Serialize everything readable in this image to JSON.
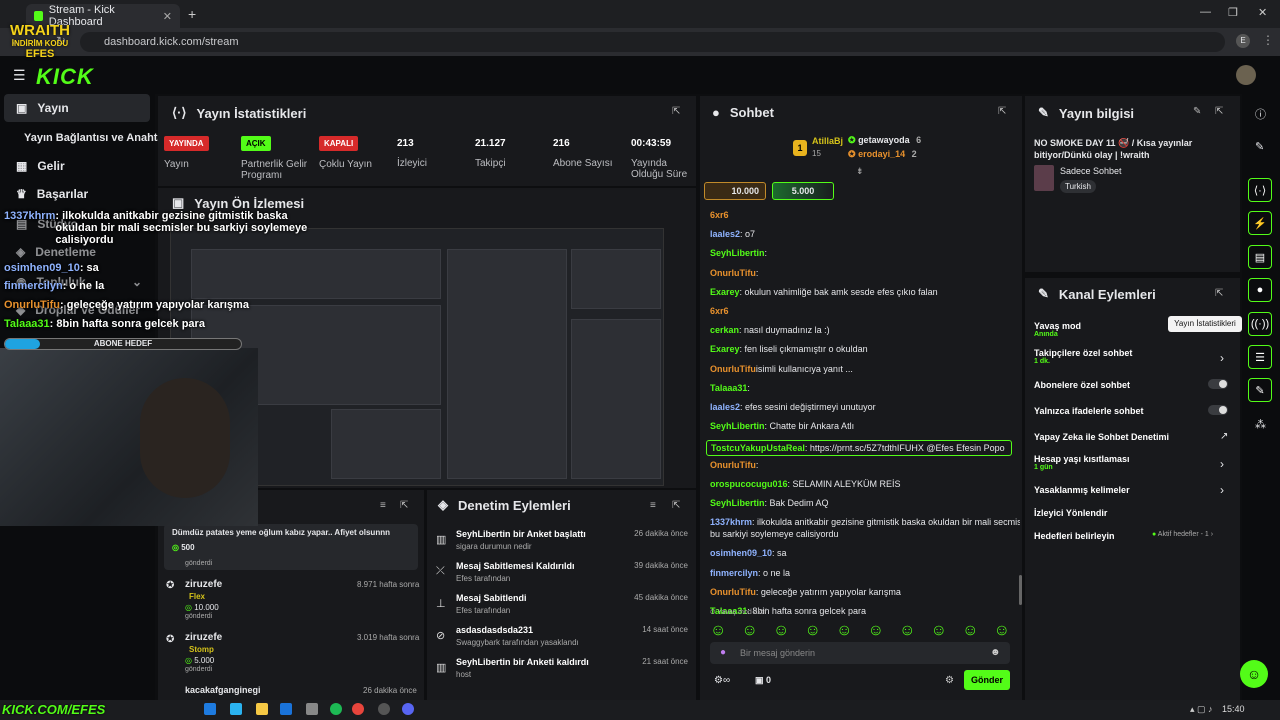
{
  "browser": {
    "tab_title": "Stream - Kick Dashboard",
    "url": "dashboard.kick.com/stream",
    "profile": "E"
  },
  "logo": "KICK",
  "overlay_brand": {
    "line1": "WRAITH",
    "line2": "İNDİRİM KODU",
    "line3": "EFES",
    "bottom": "KICK.COM/EFES"
  },
  "nav": {
    "items": [
      {
        "label": "Yayın"
      },
      {
        "label": "Gelir"
      },
      {
        "label": "Başarılar"
      },
      {
        "label": "Stüdyo"
      },
      {
        "label": "Denetleme"
      },
      {
        "label": "Topluluk"
      },
      {
        "label": "Droplar ve Ödüller"
      }
    ],
    "sub": "Yayın Bağlantısı ve Anahtarı"
  },
  "stats": {
    "title": "Yayın İstatistikleri",
    "items": [
      {
        "badge": "YAYINDA",
        "label": "Yayın"
      },
      {
        "badge": "AÇIK",
        "label": "Partnerlik Gelir Programı"
      },
      {
        "badge": "KAPALI",
        "label": "Çoklu Yayın"
      },
      {
        "value": "213",
        "label": "İzleyici"
      },
      {
        "value": "21.127",
        "label": "Takipçi"
      },
      {
        "value": "216",
        "label": "Abone Sayısı"
      },
      {
        "value": "00:43:59",
        "label": "Yayında Olduğu Süre"
      }
    ]
  },
  "preview": {
    "title": "Yayın Ön İzlemesi"
  },
  "overlay_chat": [
    {
      "user": "1337khrm",
      "text": ": ilkokulda anitkabir gezisine gitmistik baska okuldan bir mali secmisler bu sarkiyi soylemeye calisiyordu"
    },
    {
      "user": "osimhen09_10",
      "text": ": sa"
    },
    {
      "user": "finmercilyn",
      "text": ": o ne la"
    },
    {
      "user": "OnurluTifu",
      "text": ": geleceğe yatırım yapıyolar karışma"
    },
    {
      "user": "Talaaa31",
      "text": ": 8bin hafta sonra gelcek para"
    }
  ],
  "abone_hedef": {
    "label": "ABONE HEDEF",
    "progress": 0.15
  },
  "activity": [
    {
      "text": "Dümdüz patates yeme oğlum kabız yapar.. Afiyet olsunnn",
      "amount": "500",
      "sub": "gönderdi"
    },
    {
      "user": "ziruzefe",
      "time": "8.971 hafta sonra",
      "item": "Flex",
      "amount": "10.000",
      "sub": "gönderdi"
    },
    {
      "user": "ziruzefe",
      "time": "3.019 hafta sonra",
      "item": "Stomp",
      "amount": "5.000",
      "sub": "gönderdi"
    },
    {
      "user": "kacakafganginegi",
      "time": "26 dakika önce"
    }
  ],
  "moderation": {
    "title": "Denetim Eylemleri",
    "items": [
      {
        "title": "SeyhLibertin bir Anket başlattı",
        "sub": "sigara durumun nedir",
        "time": "26 dakika önce"
      },
      {
        "title": "Mesaj Sabitlemesi Kaldırıldı",
        "sub": "Efes tarafından",
        "time": "39 dakika önce"
      },
      {
        "title": "Mesaj Sabitlendi",
        "sub": "Efes tarafından",
        "time": "45 dakika önce"
      },
      {
        "title": "asdasdasdsda231",
        "sub": "Swaggybark tarafından yasaklandı",
        "time": "14 saat önce"
      },
      {
        "title": "SeyhLibertin bir Anketi kaldırdı",
        "sub": "host",
        "time": "21 saat önce"
      }
    ]
  },
  "chat": {
    "title": "Sohbet",
    "top": [
      {
        "name": "AtillaBj",
        "count": "15"
      },
      {
        "name": "getawayoda",
        "count": "6"
      },
      {
        "name": "erodayi_14",
        "count": "2"
      }
    ],
    "rank": "1",
    "goals": [
      "10.000",
      "5.000"
    ],
    "messages": [
      {
        "user": "6xr6",
        "text": ""
      },
      {
        "user": "laales2",
        "text": ": o7"
      },
      {
        "user": "SeyhLibertin",
        "text": ":"
      },
      {
        "user": "OnurluTifu",
        "text": ":"
      },
      {
        "user": "Exarey",
        "text": ": okulun vahimliğe bak amk sesde efes çıkıo falan"
      },
      {
        "user": "6xr6",
        "text": ""
      },
      {
        "user": "cerkan",
        "text": ": nasıl duymadınız la :)"
      },
      {
        "user": "Exarey",
        "text": ": fen liseli çıkmamıştır o okuldan"
      },
      {
        "user": "OnurluTifu",
        "text": "isimli kullanıcıya yanıt ..."
      },
      {
        "user": "Talaaa31",
        "text": ":"
      },
      {
        "user": "laales2",
        "text": ": efes sesini değiştirmeyi unutuyor"
      },
      {
        "user": "SeyhLibertin",
        "text": ": Chatte bir Ankara Atlı"
      },
      {
        "user": "TostcuYakupUstaReal",
        "text": ": https://prnt.sc/5Z7tdthIFUHX @Efes Efesin Popo"
      },
      {
        "user": "OnurluTifu",
        "text": ":"
      },
      {
        "user": "orospucocugu016",
        "text": ": SELAMIN ALEYKÜM REİS"
      },
      {
        "user": "SeyhLibertin",
        "text": ": Bak Dedim AQ"
      },
      {
        "user": "1337khrm",
        "text": ": ilkokulda anitkabir gezisine gitmistik baska okuldan bir mali secmisler"
      },
      {
        "user": "",
        "text": "bu sarkiyi soylemeye calisiyordu"
      },
      {
        "user": "osimhen09_10",
        "text": ": sa"
      },
      {
        "user": "finmercilyn",
        "text": ": o ne la"
      },
      {
        "user": "OnurluTifu",
        "text": ": geleceğe yatırım yapıyolar karışma"
      },
      {
        "user": "Talaaa31",
        "text": ": 8bin hafta sonra gelcek para"
      }
    ],
    "slow_mode": "Yavaş mod aktif",
    "input_placeholder": "Bir mesaj gönderin",
    "viewers": "0",
    "send": "Gönder"
  },
  "stream_info": {
    "title": "Yayın bilgisi",
    "stream_title": "NO SMOKE DAY 11 🚭 / Kısa yayınlar bitiyor/Dünkü olay | !wraith",
    "category": "Sadece Sohbet",
    "tag": "Turkish"
  },
  "channel_actions": {
    "title": "Kanal Eylemleri",
    "tooltip": "Yayın İstatistikleri",
    "items": [
      {
        "label": "Yavaş mod",
        "sub": "Anında"
      },
      {
        "label": "Takipçilere özel sohbet",
        "sub": "1 dk."
      },
      {
        "label": "Abonelere özel sohbet"
      },
      {
        "label": "Yalnızca ifadelerle sohbet"
      },
      {
        "label": "Yapay Zeka ile Sohbet Denetimi"
      },
      {
        "label": "Hesap yaşı kısıtlaması",
        "sub": "1 gün"
      },
      {
        "label": "Yasaklanmış kelimeler"
      },
      {
        "label": "İzleyici Yönlendir"
      },
      {
        "label": "Hedefleri belirleyin",
        "extra": "Aktif hedefler - 1"
      }
    ]
  },
  "taskbar": {
    "time": "15:40"
  },
  "colors": {
    "accent": "#53fc18",
    "live": "#d62a2a",
    "panel": "#18191c"
  }
}
